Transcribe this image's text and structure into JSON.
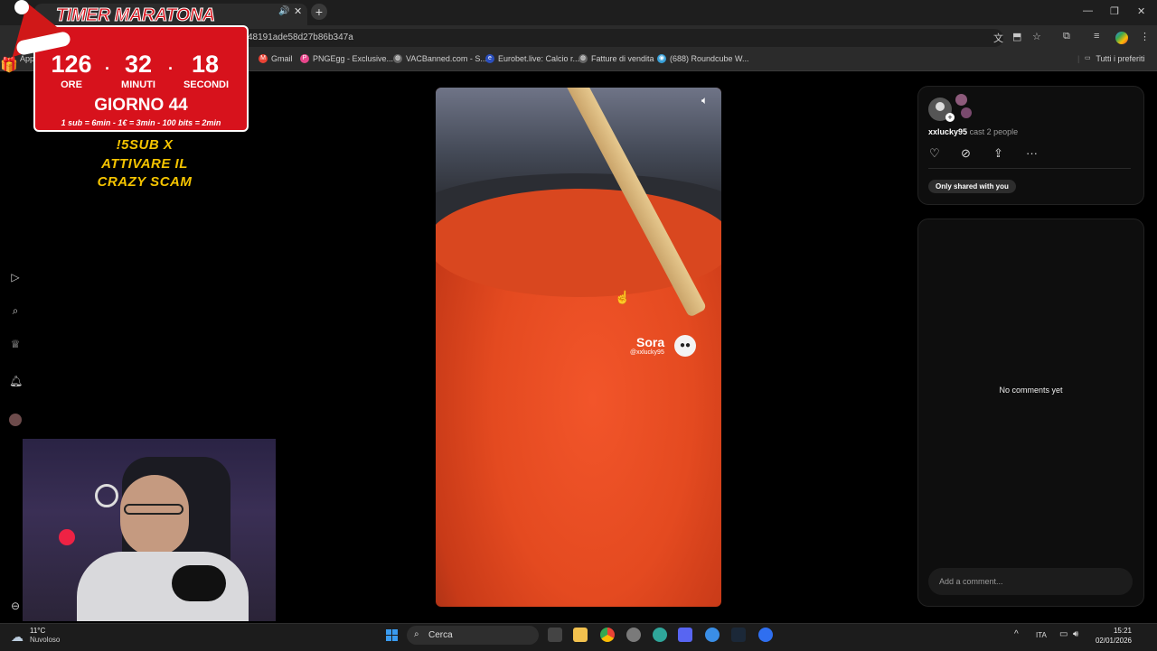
{
  "browser": {
    "tab_title": "TIMER MARATONA",
    "url": "48191ade58d27b86b347a",
    "new_tab": "+",
    "tab_audio_icon": "speaker-icon",
    "bookmarks": [
      {
        "label": "Gmail",
        "icon": "gmail-icon",
        "color": "#ea4335"
      },
      {
        "label": "PNGEgg - Exclusive...",
        "icon": "pngegg-icon",
        "color": "#e8468b"
      },
      {
        "label": "VACBanned.com - S...",
        "icon": "globe-icon",
        "color": "#666666"
      },
      {
        "label": "Eurobet.live: Calcio r...",
        "icon": "eurobet-icon",
        "color": "#2b4fbd"
      },
      {
        "label": "Fatture di vendita",
        "icon": "globe-icon",
        "color": "#666666"
      },
      {
        "label": "(688) Roundcube W...",
        "icon": "roundcube-icon",
        "color": "#39a0d8"
      }
    ],
    "all_bookmarks": "Tutti i preferiti",
    "apps_label": "App"
  },
  "overlay": {
    "title": "TIMER MARATONA",
    "hours": "126",
    "hours_label": "ORE",
    "minutes": "32",
    "minutes_label": "MINUTI",
    "seconds": "18",
    "seconds_label": "SECONDI",
    "day": "GIORNO 44",
    "rates": "1 sub = 6min - 1€ = 3min - 100 bits = 2min",
    "sub_line1": "!5SUB X",
    "sub_line2": "ATTIVARE IL",
    "sub_line3": "CRAZY SCAM"
  },
  "video": {
    "watermark": "Sora",
    "watermark_handle": "@xxlucky95"
  },
  "post": {
    "username": "xxlucky95",
    "caption_suffix": "cast 2 people",
    "visibility_badge": "Only shared with you",
    "no_comments": "No comments yet",
    "comment_placeholder": "Add a comment..."
  },
  "taskbar": {
    "temperature": "11°C",
    "weather": "Nuvoloso",
    "search_label": "Cerca",
    "language": "ITA",
    "time": "15:21",
    "date": "02/01/2026"
  }
}
